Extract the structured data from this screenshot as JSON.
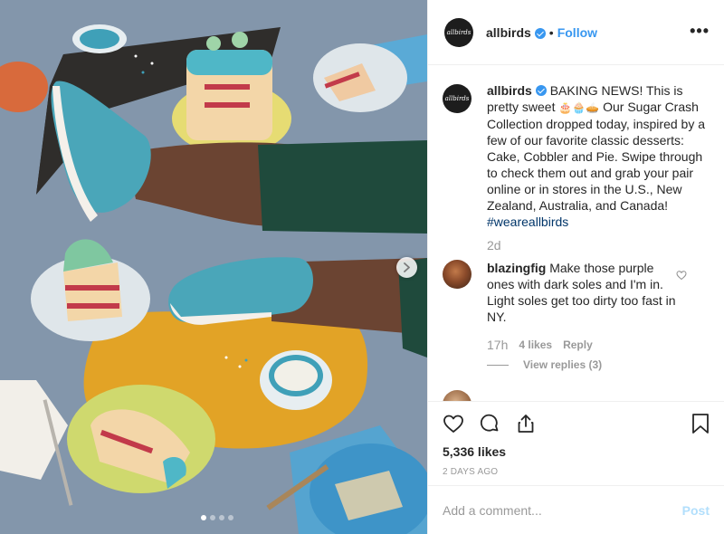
{
  "post": {
    "account": "allbirds",
    "avatar_text": "allbirds",
    "follow_label": "Follow",
    "separator": "•",
    "more_label": "•••",
    "caption": {
      "username": "allbirds",
      "text_before": "BAKING NEWS! This is pretty sweet ",
      "emojis": "🎂🧁🥧",
      "text_after": " Our Sugar Crash Collection dropped today, inspired by a few of our favorite classic desserts: Cake, Cobbler and Pie. Swipe through to check them out and grab your pair online or in stores in the U.S., New Zealand, Australia, and Canada! ",
      "hashtag": "#weareallbirds",
      "age": "2d"
    },
    "comments": [
      {
        "username": "blazingfig",
        "text": "Make those purple ones with dark soles and I'm in. Light soles get too dirty too fast in NY.",
        "time": "17h",
        "likes": "4 likes",
        "reply_label": "Reply",
        "view_replies": "View replies (3)"
      },
      {
        "username": "",
        "text": ""
      }
    ],
    "likes": "5,336 likes",
    "date": "2 DAYS AGO",
    "add_comment_placeholder": "Add a comment...",
    "post_label": "Post",
    "carousel": {
      "slides": 4,
      "active": 1
    }
  },
  "icons": {
    "like": "heart-icon",
    "comment": "comment-icon",
    "share": "share-icon",
    "save": "bookmark-icon",
    "next": "chevron-right-icon"
  },
  "colors": {
    "link": "#3897f0",
    "hashtag": "#003569",
    "muted": "#999999",
    "post_disabled": "#b2dffc",
    "divider": "#efefef"
  }
}
